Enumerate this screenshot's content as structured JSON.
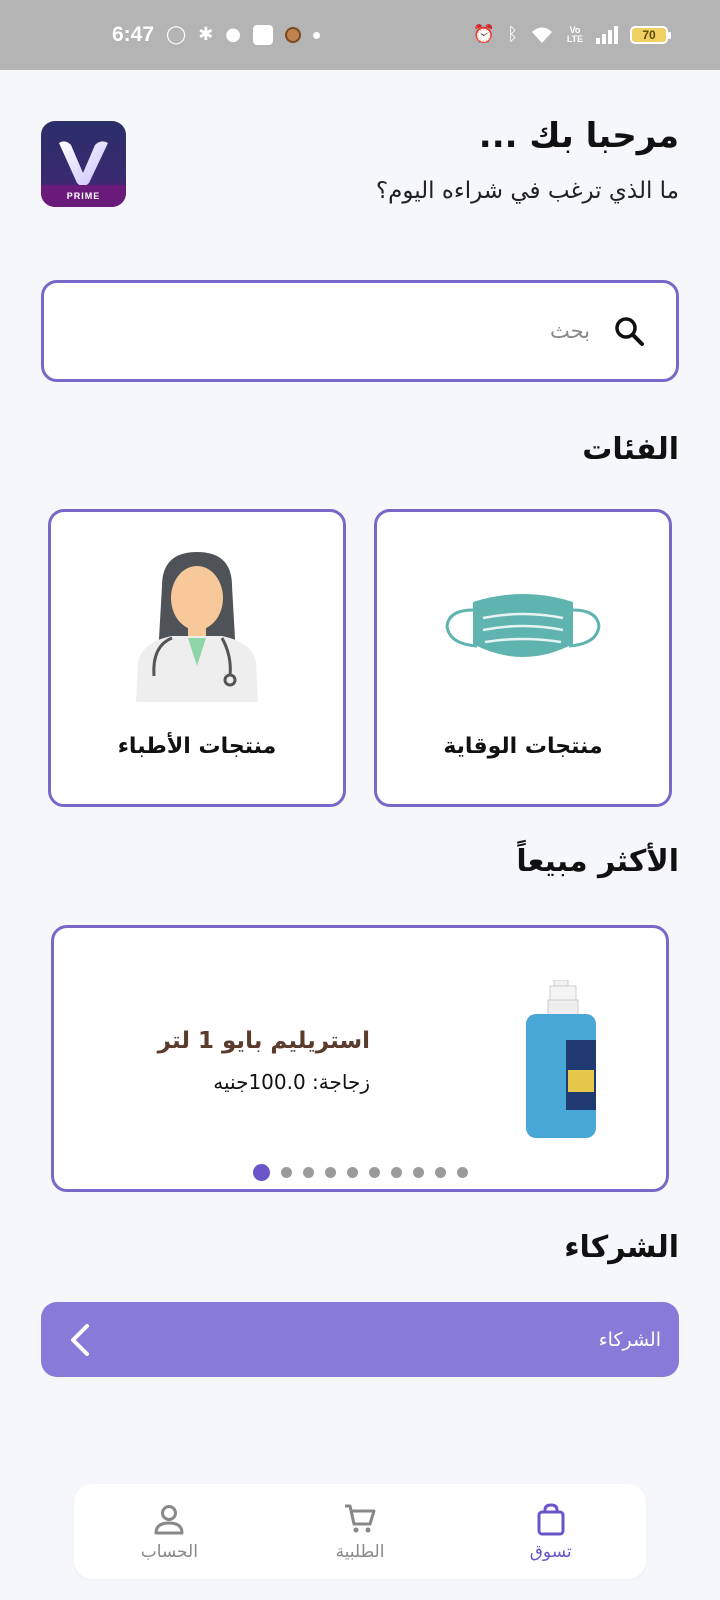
{
  "status_bar": {
    "time": "6:47",
    "battery": "70",
    "network_label": "Vo LTE"
  },
  "header": {
    "logo_text": "PRIME",
    "greeting": "مرحبا بك ...",
    "subtitle": "ما الذي ترغب في شراءه اليوم؟"
  },
  "search": {
    "placeholder": "بحث"
  },
  "categories": {
    "title": "الفئات",
    "items": [
      {
        "label": "منتجات الوقاية",
        "icon": "face-mask-icon"
      },
      {
        "label": "منتجات الأطباء",
        "icon": "doctor-icon"
      }
    ]
  },
  "best_sellers": {
    "title": "الأكثر مبيعاً",
    "product": {
      "name": "استريليم بايو 1 لتر",
      "price": "زجاجة: 100.0جنيه"
    },
    "carousel_count": 10,
    "carousel_active": 1
  },
  "partners": {
    "title": "الشركاء",
    "bar_label": "الشركاء"
  },
  "bottom_nav": {
    "items": [
      {
        "label": "تسوق",
        "icon": "shopping-bag-icon",
        "active": true
      },
      {
        "label": "الطلبية",
        "icon": "cart-icon",
        "active": false
      },
      {
        "label": "الحساب",
        "icon": "person-icon",
        "active": false
      }
    ]
  },
  "colors": {
    "accent": "#7a68c8",
    "partners_bar": "#877ad8",
    "background": "#f6f7fa",
    "price_title": "#5a3b2c"
  }
}
